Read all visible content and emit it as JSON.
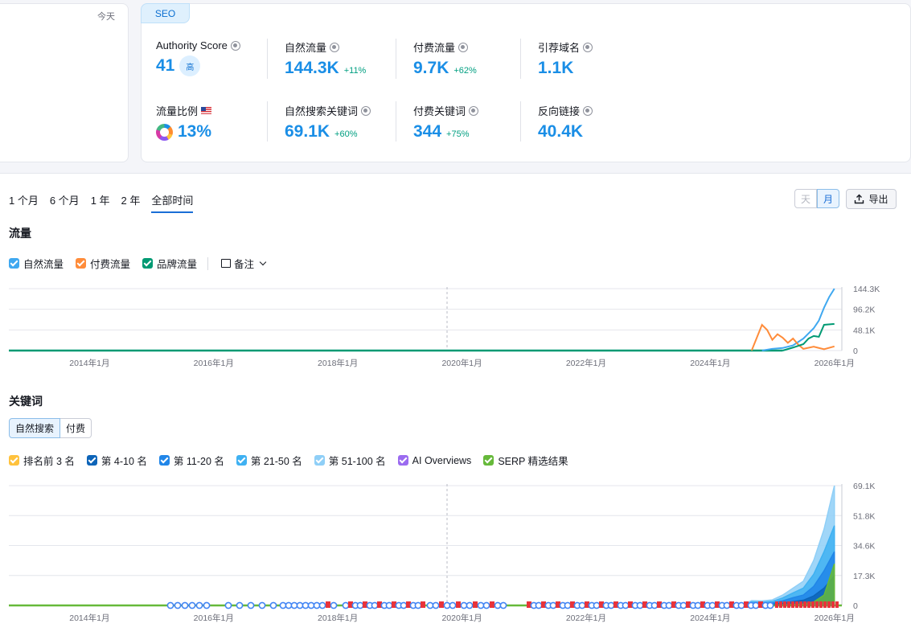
{
  "left_card": {
    "today": "今天"
  },
  "seo": {
    "tab": "SEO",
    "metrics": {
      "authority": {
        "label": "Authority Score",
        "value": "41",
        "badge": "高"
      },
      "organic_traffic": {
        "label": "自然流量",
        "value": "144.3K",
        "change": "+11%"
      },
      "paid_traffic": {
        "label": "付费流量",
        "value": "9.7K",
        "change": "+62%"
      },
      "ref_domains": {
        "label": "引荐域名",
        "value": "1.1K"
      },
      "traffic_share": {
        "label": "流量比例",
        "value": "13%"
      },
      "organic_keywords": {
        "label": "自然搜索关键词",
        "value": "69.1K",
        "change": "+60%"
      },
      "paid_keywords": {
        "label": "付费关键词",
        "value": "344",
        "change": "+75%"
      },
      "backlinks": {
        "label": "反向链接",
        "value": "40.4K"
      }
    }
  },
  "periods": [
    "1 个月",
    "6 个月",
    "1 年",
    "2 年",
    "全部时间"
  ],
  "active_period": "全部时间",
  "granularity": {
    "day": "天",
    "month": "月",
    "selected": "月"
  },
  "export_label": "导出",
  "traffic": {
    "title": "流量",
    "legend": [
      {
        "label": "自然流量",
        "color": "#3fa8f0"
      },
      {
        "label": "付费流量",
        "color": "#ff8c3a"
      },
      {
        "label": "品牌流量",
        "color": "#009a73"
      }
    ],
    "note_label": "备注"
  },
  "keywords": {
    "title": "关键词",
    "tabs": [
      "自然搜索",
      "付费"
    ],
    "active_tab": "自然搜索",
    "legend": [
      {
        "label": "排名前 3 名",
        "color": "#ffc23d"
      },
      {
        "label": "第 4-10 名",
        "color": "#0d64b8"
      },
      {
        "label": "第 11-20 名",
        "color": "#2186e8"
      },
      {
        "label": "第 21-50 名",
        "color": "#3fb1f2"
      },
      {
        "label": "第 51-100 名",
        "color": "#8fcff7"
      },
      {
        "label": "AI Overviews",
        "color": "#9b6bf0"
      },
      {
        "label": "SERP 精选结果",
        "color": "#66b93a"
      }
    ]
  },
  "chart_data": [
    {
      "type": "line",
      "title": "流量",
      "x_ticks": [
        "2014年1月",
        "2016年1月",
        "2018年1月",
        "2020年1月",
        "2022年1月",
        "2024年1月",
        "2026年1月"
      ],
      "y_ticks": [
        "0",
        "48.1K",
        "96.2K",
        "144.3K"
      ],
      "ylim": [
        0,
        144300
      ],
      "series": [
        {
          "name": "自然流量",
          "color": "#3fa8f0",
          "x": [
            "2024年11月",
            "2025年1月",
            "2025年3月",
            "2025年5月",
            "2025年7月",
            "2025年8月",
            "2025年9月",
            "2025年10月",
            "2025年11月",
            "2025年12月",
            "2026年1月"
          ],
          "values": [
            0,
            4000,
            6000,
            12000,
            28000,
            40000,
            52000,
            70000,
            100000,
            125000,
            144300
          ]
        },
        {
          "name": "付费流量",
          "color": "#ff8c3a",
          "x": [
            "2024年9月",
            "2024年10月",
            "2024年11月",
            "2024年12月",
            "2025年1月",
            "2025年2月",
            "2025年3月",
            "2025年4月",
            "2025年5月",
            "2025年6月",
            "2025年7月",
            "2025年9月",
            "2025年11月",
            "2026年1月"
          ],
          "values": [
            0,
            30000,
            60000,
            48000,
            25000,
            38000,
            30000,
            18000,
            28000,
            14000,
            4000,
            9000,
            3000,
            9700
          ]
        },
        {
          "name": "品牌流量",
          "color": "#009a73",
          "x": [
            "2025年3月",
            "2025年5月",
            "2025年7月",
            "2025年8月",
            "2025年9月",
            "2025年10月",
            "2025年11月",
            "2026年1月"
          ],
          "values": [
            0,
            7000,
            15000,
            28000,
            34000,
            32000,
            60000,
            62000
          ]
        }
      ]
    },
    {
      "type": "area",
      "title": "关键词",
      "x_ticks": [
        "2014年1月",
        "2016年1月",
        "2018年1月",
        "2020年1月",
        "2022年1月",
        "2024年1月",
        "2026年1月"
      ],
      "y_ticks": [
        "0",
        "17.3K",
        "34.6K",
        "51.8K",
        "69.1K"
      ],
      "ylim": [
        0,
        69100
      ],
      "series": [
        {
          "name": "第 51-100 名",
          "color": "#8fcff7",
          "x": [
            "2024年7月",
            "2024年9月",
            "2024年11月",
            "2025年1月",
            "2025年3月",
            "2025年5月",
            "2025年7月",
            "2025年9月",
            "2025年11月",
            "2026年1月"
          ],
          "values": [
            0,
            2800,
            2600,
            3200,
            6000,
            10000,
            14000,
            26000,
            44000,
            69100
          ]
        },
        {
          "name": "第 21-50 名",
          "color": "#3fb1f2",
          "x": [
            "2024年7月",
            "2024年9月",
            "2024年11月",
            "2025年1月",
            "2025年3月",
            "2025年5月",
            "2025年7月",
            "2025年9月",
            "2025年11月",
            "2026年1月"
          ],
          "values": [
            0,
            2000,
            1800,
            2300,
            4300,
            7200,
            10000,
            18000,
            31000,
            46000
          ]
        },
        {
          "name": "第 11-20 名",
          "color": "#2186e8",
          "x": [
            "2024年7月",
            "2024年9月",
            "2024年11月",
            "2025年1月",
            "2025年3月",
            "2025年5月",
            "2025年7月",
            "2025年9月",
            "2025年11月",
            "2026年1月"
          ],
          "values": [
            0,
            1200,
            1000,
            1400,
            2600,
            4500,
            6000,
            11000,
            20000,
            31000
          ]
        },
        {
          "name": "第 4-10 名",
          "color": "#0d64b8",
          "x": [
            "2024年7月",
            "2024年9月",
            "2024年11月",
            "2025年1月",
            "2025年3月",
            "2025年5月",
            "2025年7月",
            "2025年9月",
            "2025年11月",
            "2026年1月"
          ],
          "values": [
            0,
            500,
            400,
            600,
            1200,
            2200,
            3000,
            5500,
            10000,
            17000
          ]
        },
        {
          "name": "SERP 精选结果",
          "color": "#66b93a",
          "x": [
            "2024年7月",
            "2025年3月",
            "2025年7月",
            "2025年9月",
            "2025年11月",
            "2026年1月"
          ],
          "values": [
            0,
            300,
            800,
            2000,
            6000,
            24000
          ]
        }
      ]
    }
  ]
}
